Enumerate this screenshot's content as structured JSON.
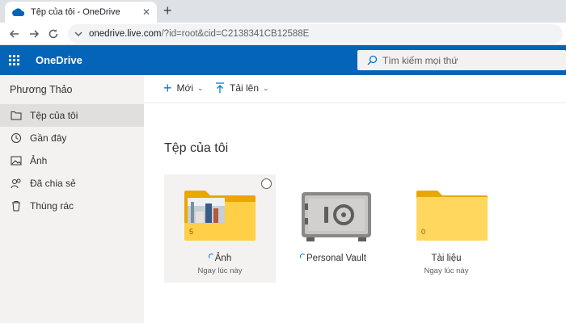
{
  "browser": {
    "tab_title": "Tệp của tôi - OneDrive",
    "close_glyph": "✕",
    "new_tab_glyph": "+",
    "url_host": "onedrive.live.com",
    "url_path": "/?id=root&cid=C2138341CB12588E"
  },
  "header": {
    "app_name": "OneDrive",
    "search_placeholder": "Tìm kiếm mọi thứ"
  },
  "sidebar": {
    "user_name": "Phương Thảo",
    "items": [
      {
        "label": "Tệp của tôi",
        "icon": "folder-icon",
        "active": true
      },
      {
        "label": "Gần đây",
        "icon": "clock-icon"
      },
      {
        "label": "Ảnh",
        "icon": "image-icon"
      },
      {
        "label": "Đã chia sẻ",
        "icon": "people-icon"
      },
      {
        "label": "Thùng rác",
        "icon": "trash-icon"
      }
    ]
  },
  "commandbar": {
    "new_label": "Mới",
    "upload_label": "Tải lên"
  },
  "main": {
    "title": "Tệp của tôi",
    "tiles": [
      {
        "name": "Ảnh",
        "meta": "Ngay lúc này",
        "count": "5",
        "type": "photo-folder"
      },
      {
        "name": "Personal Vault",
        "meta": "",
        "type": "vault"
      },
      {
        "name": "Tài liệu",
        "meta": "Ngay lúc này",
        "count": "0",
        "type": "folder"
      }
    ]
  },
  "colors": {
    "brand_blue": "#0364b8",
    "accent": "#0078d4",
    "folder_yellow": "#ffd75e"
  }
}
